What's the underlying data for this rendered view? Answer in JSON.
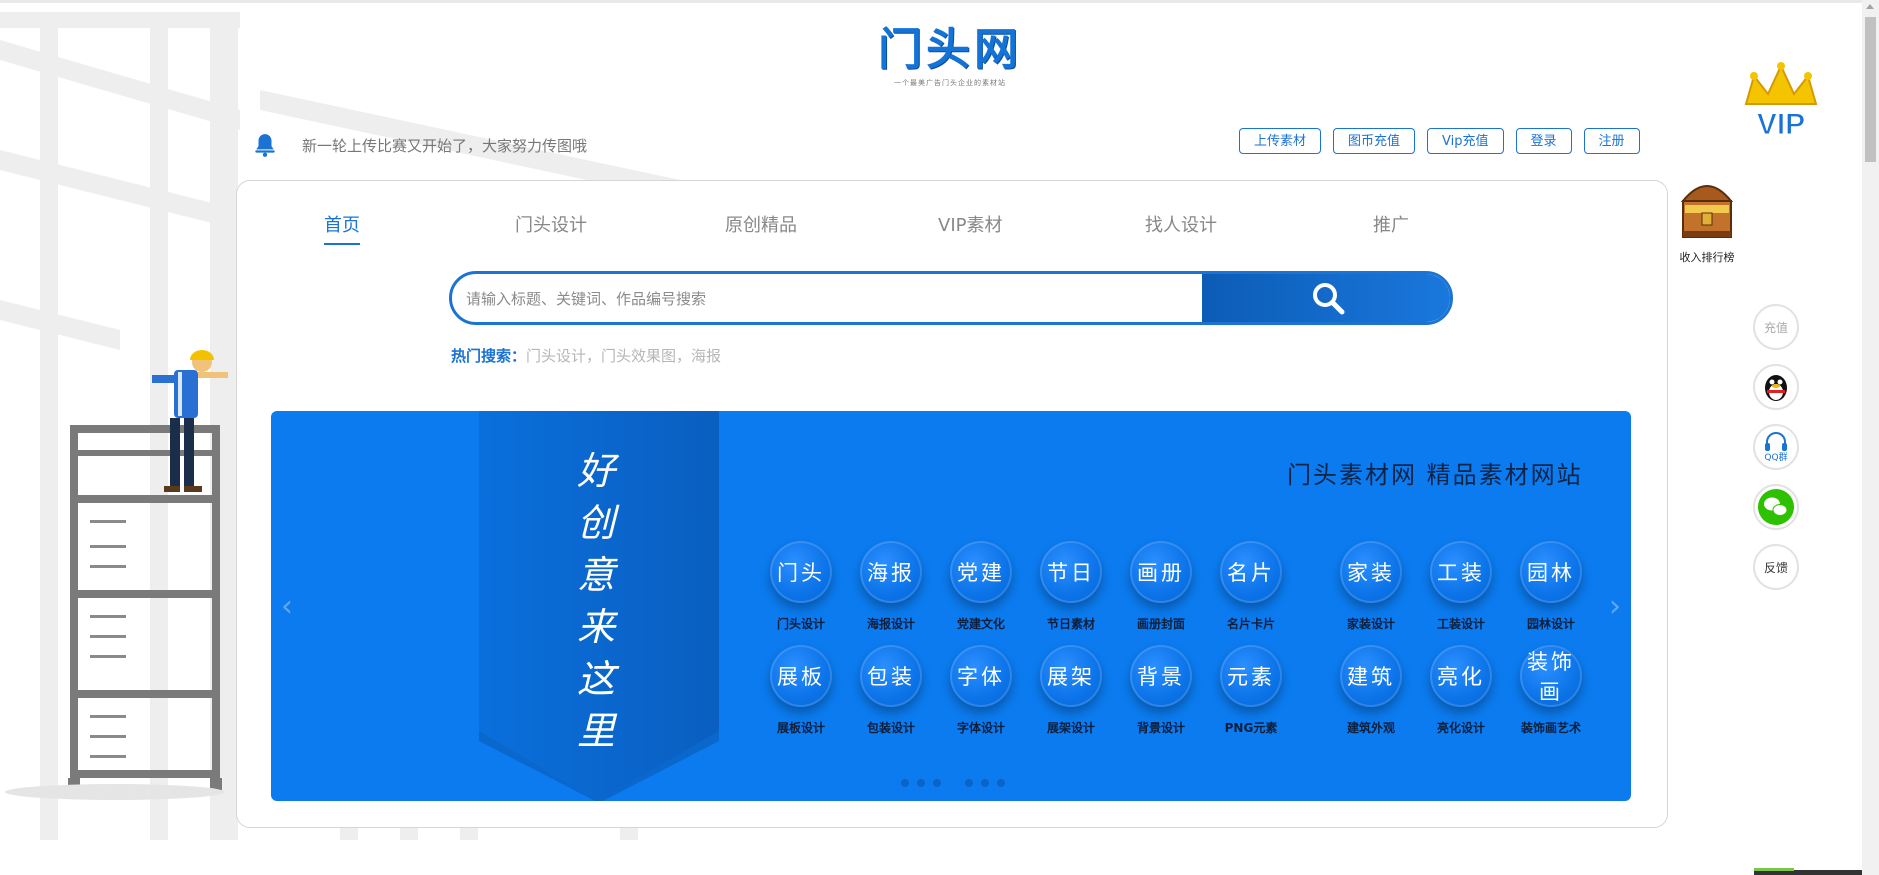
{
  "logo": {
    "title": "门头网",
    "subtitle": "一个最美广告门头企业的素材站"
  },
  "notice": {
    "text": "新一轮上传比赛又开始了，大家努力传图哦",
    "icon": "bell-icon"
  },
  "top_actions": [
    "上传素材",
    "图币充值",
    "Vip充值",
    "登录",
    "注册"
  ],
  "vip": {
    "label": "VIP",
    "icon": "crown-icon"
  },
  "income_rank": {
    "label": "收入排行榜",
    "icon": "treasure-chest-icon"
  },
  "side_tools": {
    "recharge": "充值",
    "qq_group": "QQ群",
    "feedback": "反馈"
  },
  "nav": {
    "items": [
      "首页",
      "门头设计",
      "原创精品",
      "VIP素材",
      "找人设计",
      "推广"
    ],
    "active": "首页"
  },
  "search": {
    "placeholder": "请输入标题、关键词、作品编号搜索"
  },
  "hot_search": {
    "label": "热门搜索：",
    "links": "门头设计，门头效果图，海报"
  },
  "banner": {
    "ribbon_text": "好创意来这里",
    "slogan": "门头素材网  精品素材网站",
    "categories": [
      {
        "circle": "门头",
        "label": "门头设计"
      },
      {
        "circle": "海报",
        "label": "海报设计"
      },
      {
        "circle": "党建",
        "label": "党建文化"
      },
      {
        "circle": "节日",
        "label": "节日素材"
      },
      {
        "circle": "画册",
        "label": "画册封面"
      },
      {
        "circle": "名片",
        "label": "名片卡片"
      },
      {
        "circle": "家装",
        "label": "家装设计"
      },
      {
        "circle": "工装",
        "label": "工装设计"
      },
      {
        "circle": "园林",
        "label": "园林设计"
      },
      {
        "circle": "展板",
        "label": "展板设计"
      },
      {
        "circle": "包装",
        "label": "包装设计"
      },
      {
        "circle": "字体",
        "label": "字体设计"
      },
      {
        "circle": "展架",
        "label": "展架设计"
      },
      {
        "circle": "背景",
        "label": "背景设计"
      },
      {
        "circle": "元素",
        "label": "PNG元素"
      },
      {
        "circle": "建筑",
        "label": "建筑外观"
      },
      {
        "circle": "亮化",
        "label": "亮化设计"
      },
      {
        "circle": "装饰画",
        "label": "装饰画艺术"
      }
    ]
  },
  "colors": {
    "brand_blue": "#1b73d3",
    "banner_blue": "#0b7bef"
  }
}
